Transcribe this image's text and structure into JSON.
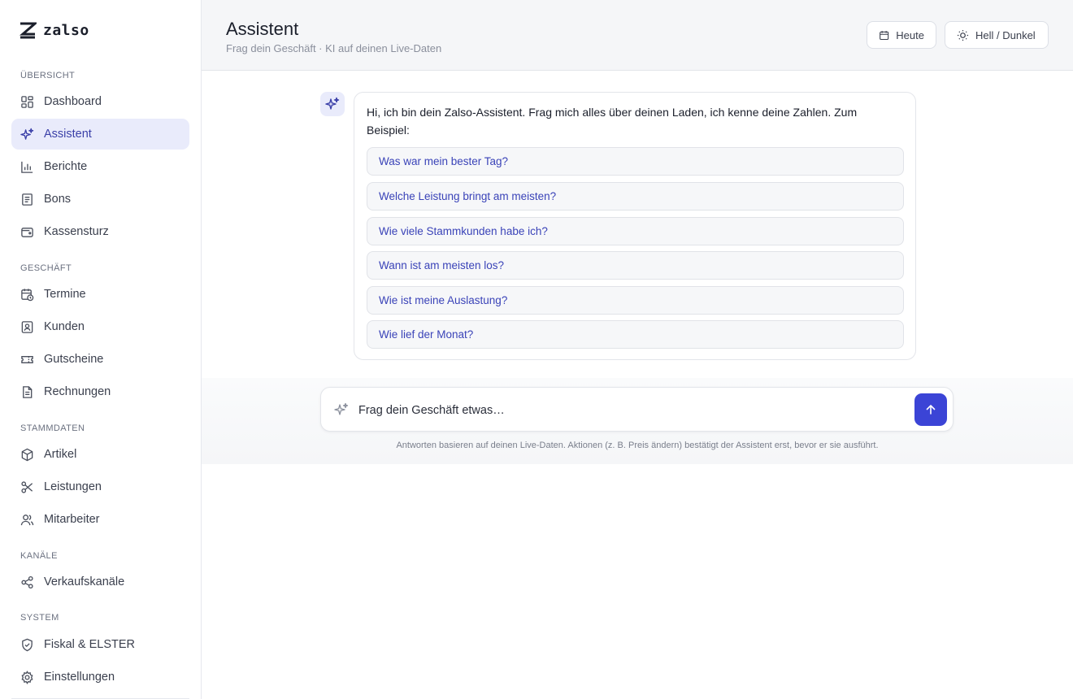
{
  "brand": {
    "name": "zalso"
  },
  "sidebar": {
    "sections": {
      "overview": "ÜBERSICHT",
      "business": "GESCHÄFT",
      "masterdata": "STAMMDATEN",
      "channels": "KANÄLE",
      "system": "SYSTEM"
    },
    "items": {
      "dashboard": "Dashboard",
      "assistant": "Assistent",
      "reports": "Berichte",
      "receipts": "Bons",
      "cashcount": "Kassensturz",
      "appointments": "Termine",
      "customers": "Kunden",
      "vouchers": "Gutscheine",
      "invoices": "Rechnungen",
      "articles": "Artikel",
      "services": "Leistungen",
      "employees": "Mitarbeiter",
      "saleschannels": "Verkaufskanäle",
      "fiscal": "Fiskal & ELSTER",
      "settings": "Einstellungen"
    },
    "active_item": "assistant"
  },
  "header": {
    "title": "Assistent",
    "subtitle": "Frag dein Geschäft · KI auf deinen Live-Daten",
    "today_label": "Heute",
    "theme_label": "Hell / Dunkel"
  },
  "chat": {
    "greeting": "Hi, ich bin dein Zalso-Assistent. Frag mich alles über deinen Laden, ich kenne deine Zahlen. Zum Beispiel:",
    "suggestions": [
      "Was war mein bester Tag?",
      "Welche Leistung bringt am meisten?",
      "Wie viele Stammkunden habe ich?",
      "Wann ist am meisten los?",
      "Wie ist meine Auslastung?",
      "Wie lief der Monat?"
    ]
  },
  "composer": {
    "placeholder": "Frag dein Geschäft etwas…",
    "disclaimer": "Antworten basieren auf deinen Live-Daten. Aktionen (z. B. Preis ändern) bestätigt der Assistent erst, bevor er sie ausführt."
  },
  "colors": {
    "accent": "#3b44d6",
    "active_bg": "#e9ebfb",
    "suggestion_text": "#3a43b8"
  }
}
